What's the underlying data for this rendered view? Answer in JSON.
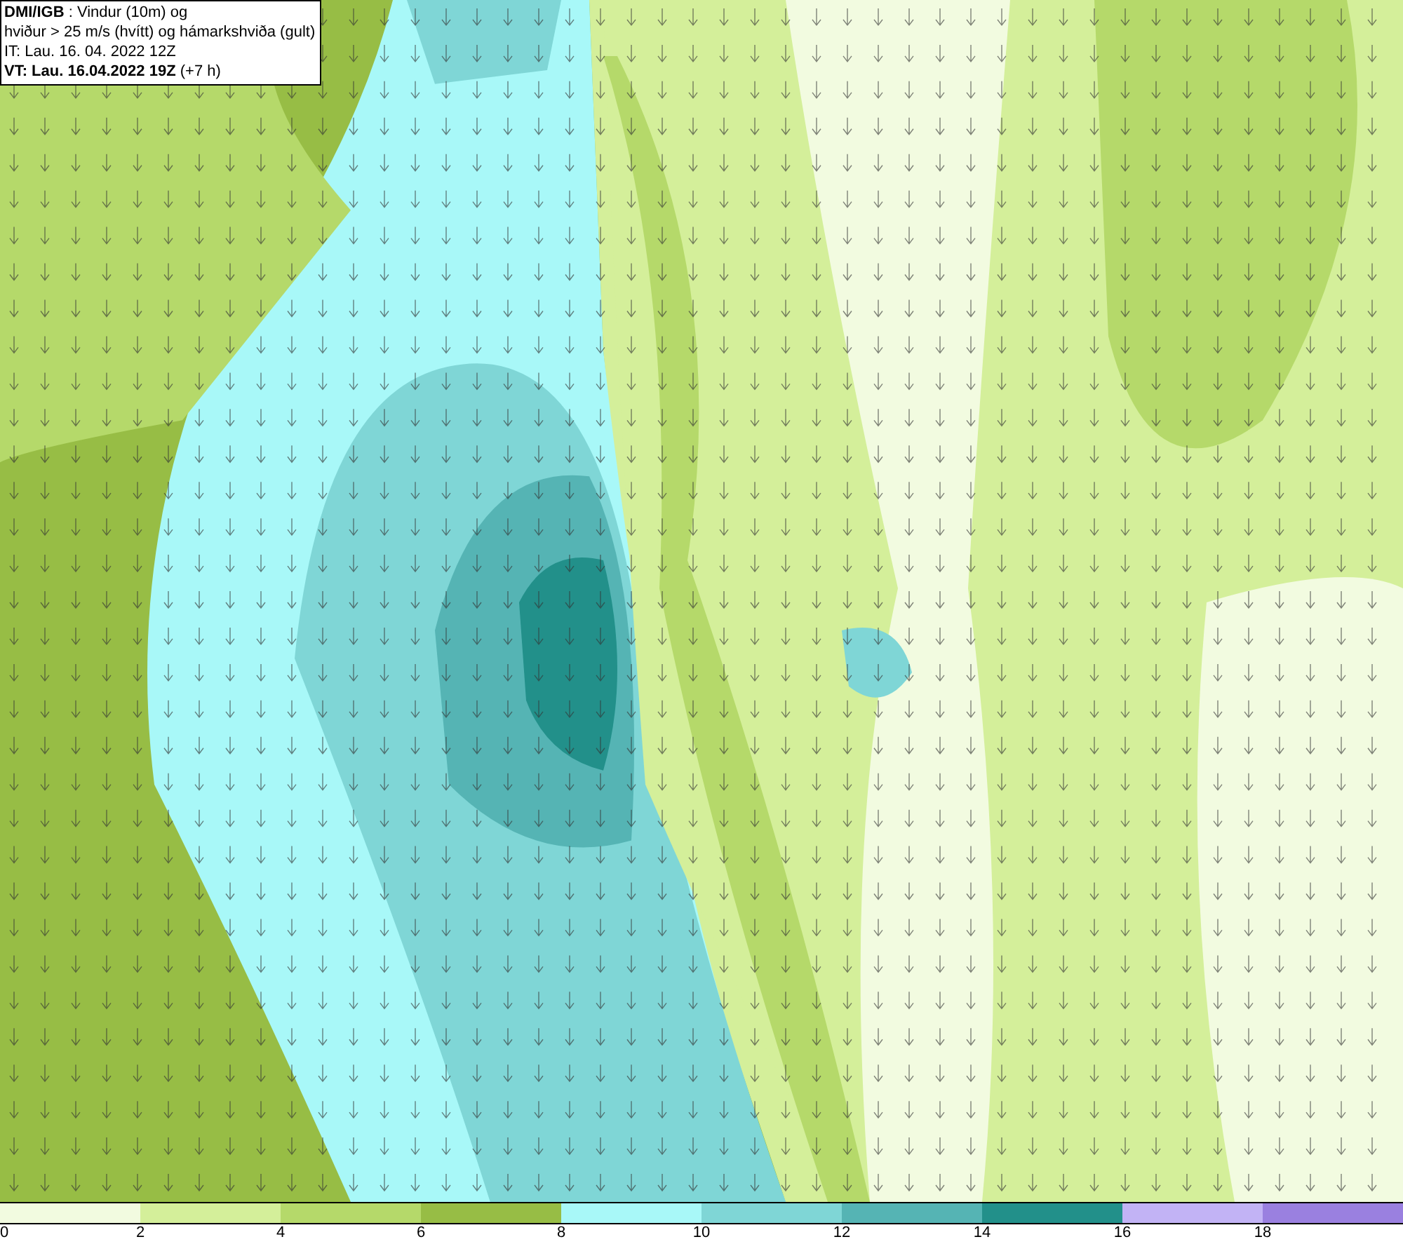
{
  "header": {
    "lines": [
      "**DMI/IGB** : Vindur (10m) og",
      "hviður > 25 m/s (hvítt) og hámarkshviða (gult)",
      "IT: Lau. 16. 04. 2022 12Z",
      "**VT: Lau. 16.04.2022 19Z** (+7 h)"
    ]
  },
  "legend": {
    "swatches": [
      {
        "color": "#f2fbe0",
        "label": "0"
      },
      {
        "color": "#d4ef9a",
        "label": "2"
      },
      {
        "color": "#b5d96a",
        "label": "4"
      },
      {
        "color": "#97bd45",
        "label": "6"
      },
      {
        "color": "#a8f8f8",
        "label": "8"
      },
      {
        "color": "#7fd6d6",
        "label": "10"
      },
      {
        "color": "#55b4b4",
        "label": "12"
      },
      {
        "color": "#22908a",
        "label": "14"
      },
      {
        "color": "#c2b3f5",
        "label": "16"
      },
      {
        "color": "#9a80e0",
        "label": "18"
      }
    ]
  }
}
